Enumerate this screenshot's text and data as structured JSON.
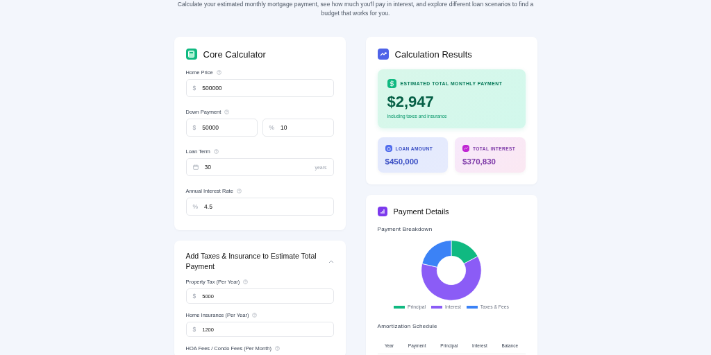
{
  "subtitle": "Calculate your estimated monthly mortgage payment, see how much you'll pay in interest, and explore different loan scenarios to find a budget that works for you.",
  "core": {
    "title": "Core Calculator",
    "fields": [
      {
        "label": "Home Price",
        "inputs": [
          {
            "kind": "prefixed",
            "prefix": "$",
            "value": "500000"
          }
        ]
      },
      {
        "label": "Down Payment",
        "inputs": [
          {
            "kind": "prefixed",
            "prefix": "$",
            "value": "50000"
          },
          {
            "kind": "prefixed",
            "prefix": "%",
            "value": "10"
          }
        ]
      },
      {
        "label": "Loan Term",
        "inputs": [
          {
            "kind": "dated",
            "value": "30",
            "suffix": "years"
          }
        ]
      },
      {
        "label": "Annual Interest Rate",
        "inputs": [
          {
            "kind": "prefixed",
            "prefix": "%",
            "value": "4.5"
          }
        ]
      }
    ]
  },
  "extras": {
    "title": "Add Taxes & Insurance to Estimate Total Payment",
    "expanded": true,
    "fields": [
      {
        "label": "Property Tax (Per Year)",
        "inputs": [
          {
            "kind": "prefixed",
            "prefix": "$",
            "value": "5000"
          }
        ]
      },
      {
        "label": "Home Insurance (Per Year)",
        "inputs": [
          {
            "kind": "prefixed",
            "prefix": "$",
            "value": "1200"
          }
        ]
      },
      {
        "label": "HOA Fees / Condo Fees (Per Month)"
      }
    ]
  },
  "results": {
    "title": "Calculation Results",
    "main": {
      "label": "ESTIMATED TOTAL MONTHLY PAYMENT",
      "value": "$2,947",
      "note": "Including taxes and insurance"
    },
    "stats": [
      {
        "kind": "loan",
        "label": "LOAN AMOUNT",
        "value": "$450,000"
      },
      {
        "kind": "interest",
        "label": "TOTAL INTEREST",
        "value": "$370,830"
      }
    ]
  },
  "details": {
    "title": "Payment Details",
    "breakdown_title": "Payment Breakdown",
    "legend": [
      {
        "label": "Principal",
        "color": "#10b981"
      },
      {
        "label": "Interest",
        "color": "#8b5cf6"
      },
      {
        "label": "Taxes & Fees",
        "color": "#3b82f6"
      }
    ],
    "schedule_title": "Amortization Schedule",
    "columns": [
      "Year",
      "Payment",
      "Principal",
      "Interest",
      "Balance"
    ]
  }
}
